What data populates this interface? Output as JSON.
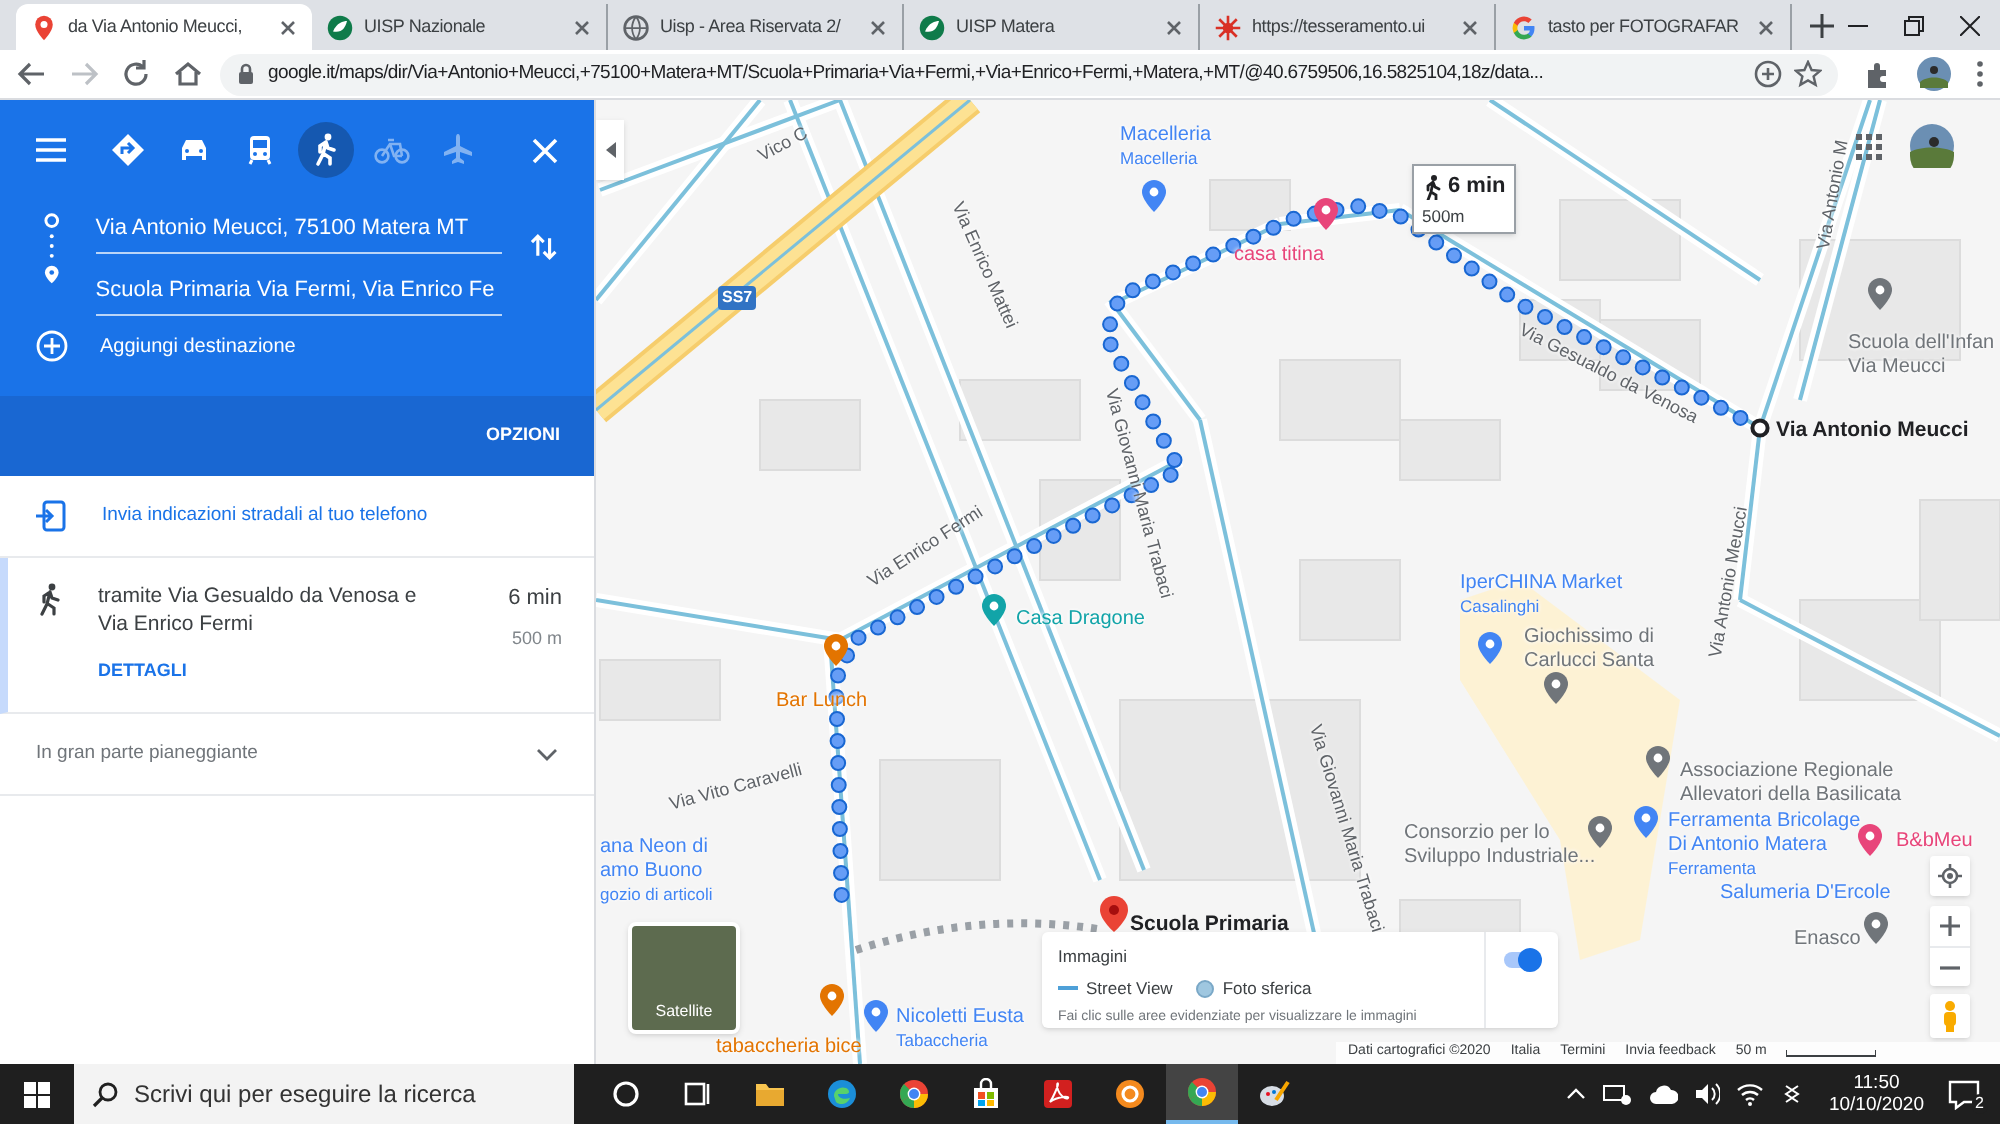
{
  "browser": {
    "tabs": [
      {
        "kind": "maps",
        "title": "da Via Antonio Meucci,",
        "selected": true
      },
      {
        "kind": "uisp",
        "title": "UISP Nazionale",
        "selected": false
      },
      {
        "kind": "globe",
        "title": "Uisp - Area Riservata 2/",
        "selected": false
      },
      {
        "kind": "uisp",
        "title": "UISP Matera",
        "selected": false
      },
      {
        "kind": "burst",
        "title": "https://tesseramento.ui",
        "selected": false
      },
      {
        "kind": "google",
        "title": "tasto per FOTOGRAFAR",
        "selected": false
      }
    ],
    "url": "google.it/maps/dir/Via+Antonio+Meucci,+75100+Matera+MT/Scuola+Primaria+Via+Fermi,+Via+Enrico+Fermi,+Matera,+MT/@40.6759506,16.5825104,18z/data..."
  },
  "sidebar": {
    "modes": [
      {
        "kind": "best",
        "selected": false,
        "disabled": false
      },
      {
        "kind": "car",
        "selected": false,
        "disabled": false
      },
      {
        "kind": "transit",
        "selected": false,
        "disabled": false
      },
      {
        "kind": "walk",
        "selected": true,
        "disabled": false
      },
      {
        "kind": "bike",
        "selected": false,
        "disabled": true
      },
      {
        "kind": "flight",
        "selected": false,
        "disabled": true
      }
    ],
    "origin": "Via Antonio Meucci, 75100 Matera MT",
    "destination": "Scuola Primaria Via Fermi, Via Enrico Fe",
    "add_destination": "Aggiungi destinazione",
    "options": "OPZIONI",
    "send_to_phone": "Invia indicazioni stradali al tuo telefono",
    "route": {
      "description": "tramite Via Gesualdo da Venosa e Via Enrico Fermi",
      "duration": "6 min",
      "distance": "500 m",
      "details": "DETTAGLI"
    },
    "terrain": "In gran parte pianeggiante"
  },
  "map": {
    "route_badge": {
      "duration": "6 min",
      "distance": "500m"
    },
    "origin_label": "Via Antonio Meucci",
    "destination_label": "Scuola Primaria",
    "highway": "SS7",
    "streets": [
      "Vico C",
      "Via Enrico Mattei",
      "Via Antonio M",
      "Via Gesualdo da Venosa",
      "Via Giovanni Maria Trabaci",
      "Via Enrico Fermi",
      "Via Antonio Meucci",
      "Via Vito Caravelli",
      "Via Giovanni Maria Trabaci"
    ],
    "places": [
      {
        "lines": [
          "Macelleria"
        ],
        "category": "Macelleria",
        "color": "#4285f4"
      },
      {
        "lines": [
          "casa titina"
        ],
        "color": "#e8457a"
      },
      {
        "lines": [
          "Scuola dell'Infan",
          "Via Meucci"
        ],
        "color": "#70757a"
      },
      {
        "lines": [
          "IperCHINA Market"
        ],
        "category": "Casalinghi",
        "color": "#4285f4"
      },
      {
        "lines": [
          "Giochissimo di",
          "Carlucci Santa"
        ],
        "color": "#70757a"
      },
      {
        "lines": [
          "Casa Dragone"
        ],
        "color": "#12a4a8"
      },
      {
        "lines": [
          "Bar Lunch"
        ],
        "color": "#e37400"
      },
      {
        "lines": [
          "Associazione Regionale",
          "Allevatori della Basilicata"
        ],
        "color": "#70757a"
      },
      {
        "lines": [
          "Consorzio per lo",
          "Sviluppo Industriale..."
        ],
        "color": "#70757a"
      },
      {
        "lines": [
          "Ferramenta Bricolage",
          "Di Antonio Matera"
        ],
        "category": "Ferramenta",
        "color": "#4285f4"
      },
      {
        "lines": [
          "B&bMeu"
        ],
        "color": "#e8457a"
      },
      {
        "lines": [
          "Salumeria D'Ercole"
        ],
        "color": "#4285f4"
      },
      {
        "lines": [
          "Enasco"
        ],
        "color": "#70757a"
      },
      {
        "lines": [
          "ana Neon di",
          "amo Buono"
        ],
        "category": "gozio di articoli",
        "color": "#4285f4"
      },
      {
        "lines": [
          "tabaccheria bice"
        ],
        "color": "#e37400"
      },
      {
        "lines": [
          "Nicoletti Eusta"
        ],
        "category": "Tabaccheria",
        "color": "#4285f4"
      }
    ],
    "layer_card": "Satellite",
    "imagery": {
      "title": "Immagini",
      "legend": [
        "Street View",
        "Foto sferica"
      ],
      "hint": "Fai clic sulle aree evidenziate per visualizzare le immagini",
      "on": true
    },
    "footer": [
      "Dati cartografici ©2020",
      "Italia",
      "Termini",
      "Invia feedback",
      "50 m"
    ]
  },
  "taskbar": {
    "search_placeholder": "Scrivi qui per eseguire la ricerca",
    "apps": [
      {
        "kind": "cortana",
        "selected": false
      },
      {
        "kind": "taskview",
        "selected": false
      },
      {
        "kind": "folder",
        "selected": false
      },
      {
        "kind": "edge",
        "selected": false
      },
      {
        "kind": "chrome",
        "selected": false
      },
      {
        "kind": "store",
        "selected": false
      },
      {
        "kind": "pdf",
        "selected": false
      },
      {
        "kind": "orange",
        "selected": false
      },
      {
        "kind": "chrome",
        "selected": true
      },
      {
        "kind": "paint",
        "selected": false
      }
    ],
    "time": "11:50",
    "date": "10/10/2020",
    "notifications": "2"
  }
}
